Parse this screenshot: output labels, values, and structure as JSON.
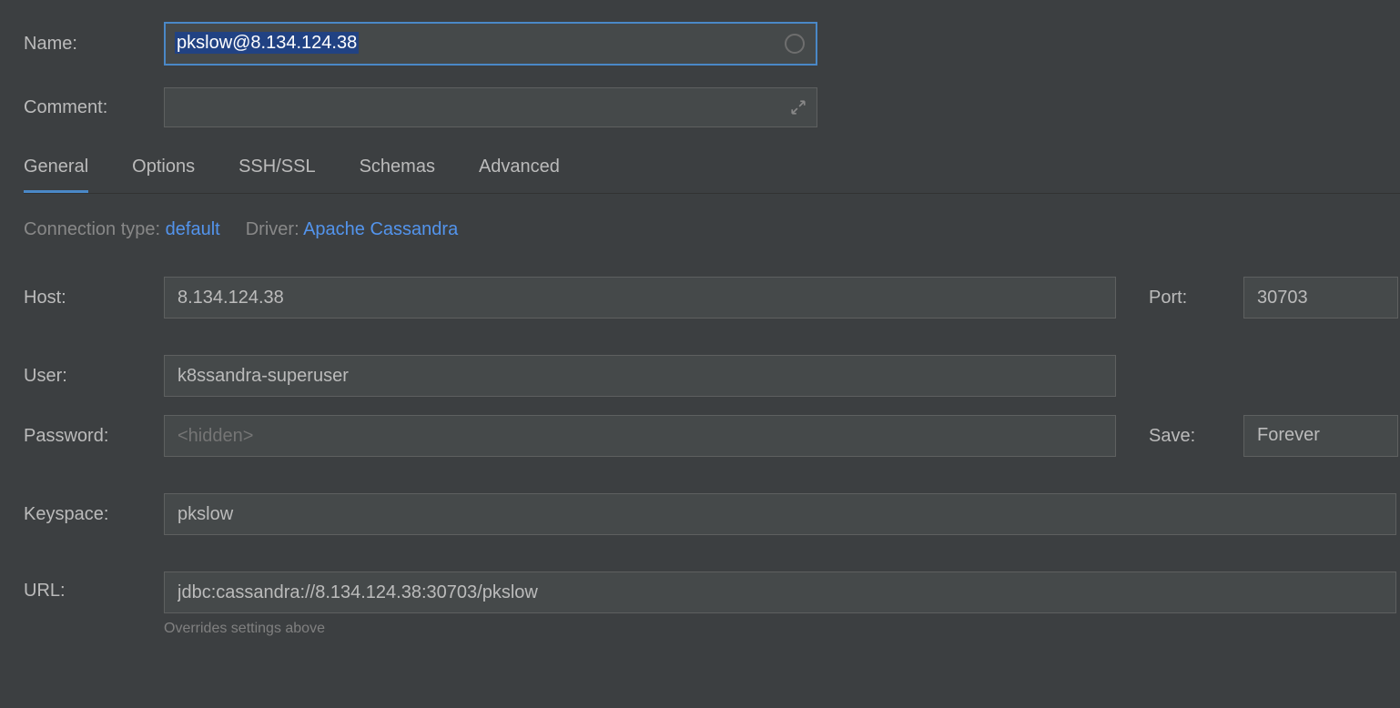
{
  "labels": {
    "name": "Name:",
    "comment": "Comment:",
    "host": "Host:",
    "port": "Port:",
    "user": "User:",
    "password": "Password:",
    "save": "Save:",
    "keyspace": "Keyspace:",
    "url": "URL:"
  },
  "fields": {
    "name": "pkslow@8.134.124.38",
    "comment": "",
    "host": "8.134.124.38",
    "port": "30703",
    "user": "k8ssandra-superuser",
    "password_placeholder": "<hidden>",
    "save": "Forever",
    "keyspace": "pkslow",
    "url": "jdbc:cassandra://8.134.124.38:30703/pkslow",
    "url_hint": "Overrides settings above"
  },
  "tabs": {
    "general": "General",
    "options": "Options",
    "ssh_ssl": "SSH/SSL",
    "schemas": "Schemas",
    "advanced": "Advanced"
  },
  "connection": {
    "type_label": "Connection type:",
    "type_value": "default",
    "driver_label": "Driver:",
    "driver_value": "Apache Cassandra"
  }
}
